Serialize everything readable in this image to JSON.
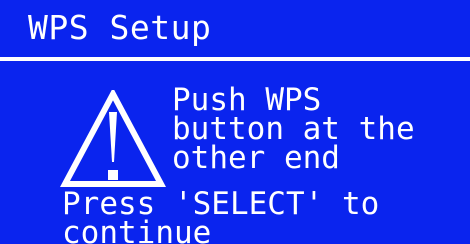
{
  "screen": {
    "title": "WPS Setup",
    "icon": "warning-icon",
    "message_lines": [
      "Push WPS",
      "button  at the",
      "other end"
    ],
    "prompt_lines": [
      "Press 'SELECT' to",
      "continue"
    ],
    "colors": {
      "background": "#0a24ee",
      "foreground": "#ffffff"
    }
  }
}
